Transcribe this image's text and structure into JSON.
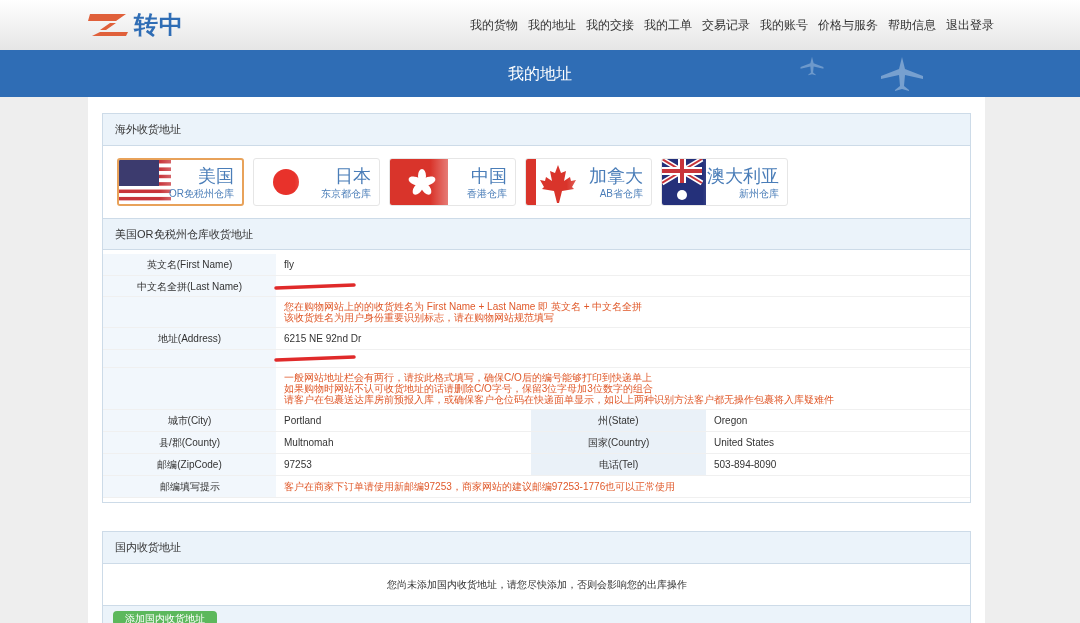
{
  "header": {
    "logo_text": "转中",
    "nav": [
      "我的货物",
      "我的地址",
      "我的交接",
      "我的工单",
      "交易记录",
      "我的账号",
      "价格与服务",
      "帮助信息",
      "退出登录"
    ]
  },
  "banner": {
    "title": "我的地址"
  },
  "overseas": {
    "title": "海外收货地址",
    "warehouses": [
      {
        "kind": "us",
        "country": "美国",
        "sub": "OR免税州仓库",
        "selected": true
      },
      {
        "kind": "jp",
        "country": "日本",
        "sub": "东京都仓库",
        "selected": false
      },
      {
        "kind": "hk",
        "country": "中国",
        "sub": "香港仓库",
        "selected": false
      },
      {
        "kind": "ca",
        "country": "加拿大",
        "sub": "AB省仓库",
        "selected": false
      },
      {
        "kind": "au",
        "country": "澳大利亚",
        "sub": "新州仓库",
        "selected": false
      }
    ]
  },
  "address": {
    "title": "美国OR免税州仓库收货地址",
    "rows": [
      {
        "kind": "field",
        "label": "英文名(First Name)",
        "value": "fly"
      },
      {
        "kind": "redacted",
        "label": "中文名全拼(Last Name)"
      },
      {
        "kind": "note",
        "lines": [
          "您在购物网站上的的收货姓名为 First Name + Last Name 即 英文名 + 中文名全拼",
          "该收货姓名为用户身份重要识别标志，请在购物网站规范填写"
        ]
      },
      {
        "kind": "field",
        "label": "地址(Address)",
        "value": "6215 NE 92nd Dr"
      },
      {
        "kind": "redacted"
      },
      {
        "kind": "note",
        "lines": [
          "一般网站地址栏会有两行，请按此格式填写，确保C/O后的编号能够打印到快递单上",
          "如果购物时网站不认可收货地址的话请删除C/O字号，保留3位字母加3位数字的组合",
          "请客户在包裹送达库房前预报入库，或确保客户仓位码在快递面单显示，如以上两种识别方法客户都无操作包裹将入库疑难件"
        ]
      },
      {
        "kind": "pair",
        "label": "城市(City)",
        "value": "Portland",
        "label2": "州(State)",
        "value2": "Oregon"
      },
      {
        "kind": "pair",
        "label": "县/郡(County)",
        "value": "Multnomah",
        "label2": "国家(Country)",
        "value2": "United States"
      },
      {
        "kind": "pair",
        "label": "邮编(ZipCode)",
        "value": "97253",
        "label2": "电话(Tel)",
        "value2": "503-894-8090"
      },
      {
        "kind": "tip",
        "label": "邮编填写提示",
        "value": "客户在商家下订单请使用新邮编97253，商家网站的建议邮编97253-1776也可以正常使用"
      }
    ]
  },
  "domestic": {
    "title": "国内收货地址",
    "message": "您尚未添加国内收货地址，请您尽快添加，否则会影响您的出库操作",
    "button": "添加国内收货地址"
  }
}
